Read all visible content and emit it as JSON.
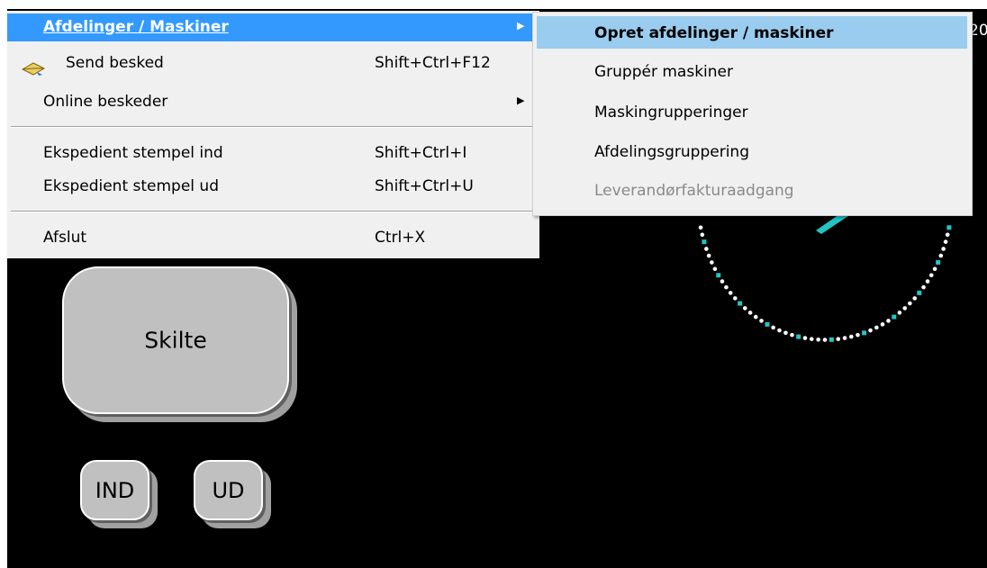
{
  "main_menu": {
    "items": [
      {
        "label": "Afdelinger / Maskiner",
        "shortcut": "",
        "has_submenu": true
      },
      {
        "label": "Send besked",
        "shortcut": "Shift+Ctrl+F12",
        "icon": "envelope-icon"
      },
      {
        "label": "Online beskeder",
        "shortcut": "",
        "has_submenu": true
      },
      {
        "label": "Ekspedient stempel ind",
        "shortcut": "Shift+Ctrl+I"
      },
      {
        "label": "Ekspedient stempel ud",
        "shortcut": "Shift+Ctrl+U"
      },
      {
        "label": "Afslut",
        "shortcut": "Ctrl+X"
      }
    ],
    "submenu_arrow": "▶"
  },
  "sub_menu": {
    "items": [
      {
        "label": "Opret afdelinger / maskiner",
        "state": "highlighted"
      },
      {
        "label": "Gruppér maskiner",
        "state": "normal"
      },
      {
        "label": "Maskingrupperinger",
        "state": "normal"
      },
      {
        "label": "Afdelingsgruppering",
        "state": "normal"
      },
      {
        "label": "Leverandørfakturaadgang",
        "state": "disabled"
      }
    ]
  },
  "background": {
    "skilte_label": "Skilte",
    "ind_label": "IND",
    "ud_label": "UD",
    "clock_fragment": "20"
  },
  "colors": {
    "highlight": "#3399ff",
    "sub_highlight": "#99ccee",
    "menu_bg": "#f0f0f0",
    "app_bg": "#000000",
    "clock_dots": "#ffffff",
    "clock_ticks": "#22c4c4"
  }
}
